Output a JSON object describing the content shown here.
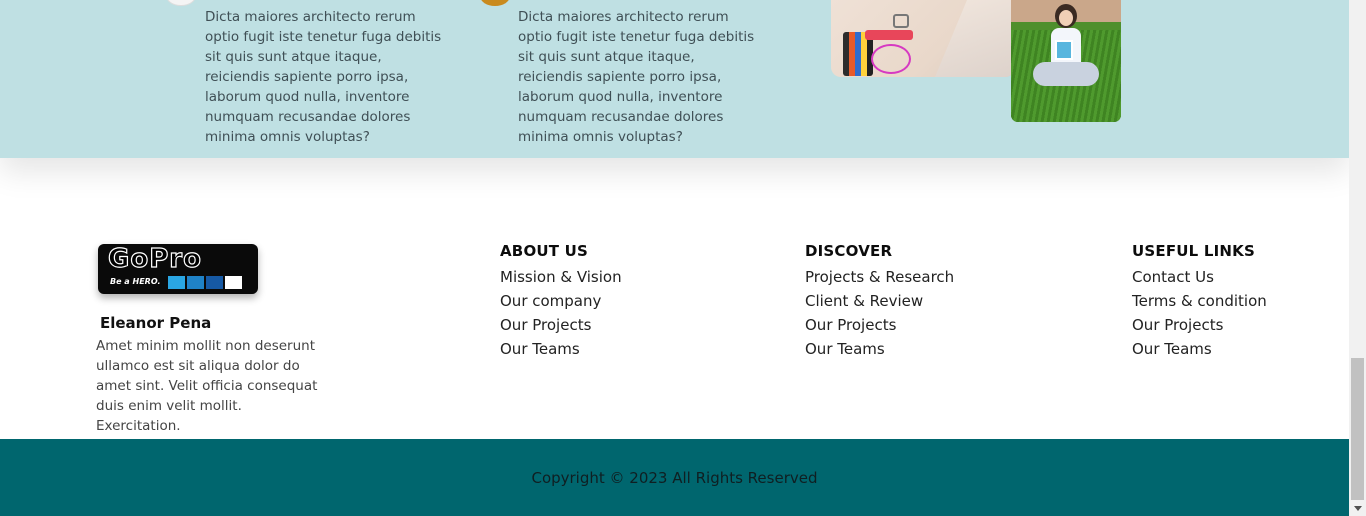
{
  "testimonials": [
    {
      "text": "Dicta maiores architecto rerum optio fugit iste tenetur fuga debitis sit quis sunt atque itaque, reiciendis sapiente porro ipsa, laborum quod nulla, inventore numquam recusandae dolores minima omnis voluptas?"
    },
    {
      "text": "Dicta maiores architecto rerum optio fugit iste tenetur fuga debitis sit quis sunt atque itaque, reiciendis sapiente porro ipsa, laborum quod nulla, inventore numquam recusandae dolores minima omnis voluptas?"
    }
  ],
  "brand": {
    "logo_text": "GoPro",
    "tagline": "Be a HERO.",
    "person_name": "Eleanor Pena",
    "bio": "Amet minim mollit non deserunt ullamco est sit aliqua dolor do amet sint. Velit officia consequat duis enim velit mollit. Exercitation."
  },
  "columns": [
    {
      "title": "ABOUT US",
      "links": [
        "Mission & Vision",
        "Our company",
        "Our Projects",
        "Our Teams"
      ]
    },
    {
      "title": "DISCOVER",
      "links": [
        "Projects & Research",
        "Client & Review",
        "Our Projects",
        "Our Teams"
      ]
    },
    {
      "title": "USEFUL LINKS",
      "links": [
        "Contact Us",
        "Terms & condition",
        "Our Projects",
        "Our Teams"
      ]
    }
  ],
  "footer": {
    "copyright": "Copyright © 2023 All Rights Reserved"
  },
  "colors": {
    "top_band": "#bfe0e3",
    "footer_bar": "#00666e",
    "logo_blue_1": "#2aa6e3",
    "logo_blue_2": "#1f82c7",
    "logo_blue_3": "#1659a4"
  }
}
